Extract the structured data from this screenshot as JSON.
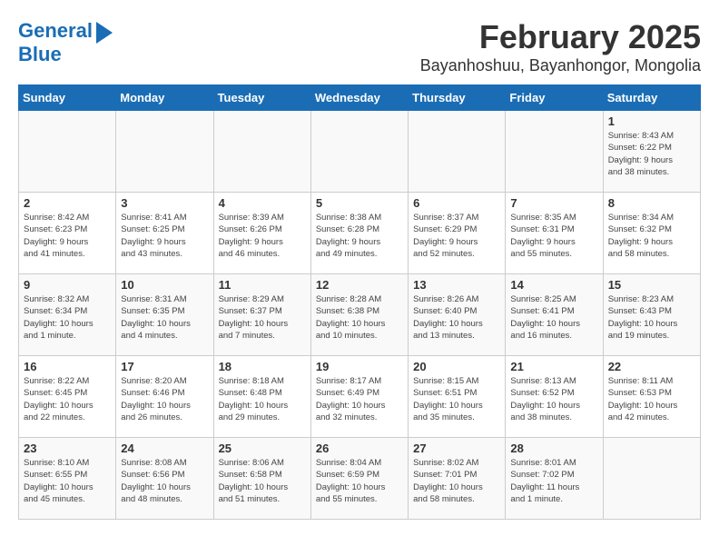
{
  "header": {
    "logo_line1": "General",
    "logo_line2": "Blue",
    "month": "February 2025",
    "location": "Bayanhoshuu, Bayanhongor, Mongolia"
  },
  "weekdays": [
    "Sunday",
    "Monday",
    "Tuesday",
    "Wednesday",
    "Thursday",
    "Friday",
    "Saturday"
  ],
  "weeks": [
    [
      {
        "day": "",
        "info": ""
      },
      {
        "day": "",
        "info": ""
      },
      {
        "day": "",
        "info": ""
      },
      {
        "day": "",
        "info": ""
      },
      {
        "day": "",
        "info": ""
      },
      {
        "day": "",
        "info": ""
      },
      {
        "day": "1",
        "info": "Sunrise: 8:43 AM\nSunset: 6:22 PM\nDaylight: 9 hours\nand 38 minutes."
      }
    ],
    [
      {
        "day": "2",
        "info": "Sunrise: 8:42 AM\nSunset: 6:23 PM\nDaylight: 9 hours\nand 41 minutes."
      },
      {
        "day": "3",
        "info": "Sunrise: 8:41 AM\nSunset: 6:25 PM\nDaylight: 9 hours\nand 43 minutes."
      },
      {
        "day": "4",
        "info": "Sunrise: 8:39 AM\nSunset: 6:26 PM\nDaylight: 9 hours\nand 46 minutes."
      },
      {
        "day": "5",
        "info": "Sunrise: 8:38 AM\nSunset: 6:28 PM\nDaylight: 9 hours\nand 49 minutes."
      },
      {
        "day": "6",
        "info": "Sunrise: 8:37 AM\nSunset: 6:29 PM\nDaylight: 9 hours\nand 52 minutes."
      },
      {
        "day": "7",
        "info": "Sunrise: 8:35 AM\nSunset: 6:31 PM\nDaylight: 9 hours\nand 55 minutes."
      },
      {
        "day": "8",
        "info": "Sunrise: 8:34 AM\nSunset: 6:32 PM\nDaylight: 9 hours\nand 58 minutes."
      }
    ],
    [
      {
        "day": "9",
        "info": "Sunrise: 8:32 AM\nSunset: 6:34 PM\nDaylight: 10 hours\nand 1 minute."
      },
      {
        "day": "10",
        "info": "Sunrise: 8:31 AM\nSunset: 6:35 PM\nDaylight: 10 hours\nand 4 minutes."
      },
      {
        "day": "11",
        "info": "Sunrise: 8:29 AM\nSunset: 6:37 PM\nDaylight: 10 hours\nand 7 minutes."
      },
      {
        "day": "12",
        "info": "Sunrise: 8:28 AM\nSunset: 6:38 PM\nDaylight: 10 hours\nand 10 minutes."
      },
      {
        "day": "13",
        "info": "Sunrise: 8:26 AM\nSunset: 6:40 PM\nDaylight: 10 hours\nand 13 minutes."
      },
      {
        "day": "14",
        "info": "Sunrise: 8:25 AM\nSunset: 6:41 PM\nDaylight: 10 hours\nand 16 minutes."
      },
      {
        "day": "15",
        "info": "Sunrise: 8:23 AM\nSunset: 6:43 PM\nDaylight: 10 hours\nand 19 minutes."
      }
    ],
    [
      {
        "day": "16",
        "info": "Sunrise: 8:22 AM\nSunset: 6:45 PM\nDaylight: 10 hours\nand 22 minutes."
      },
      {
        "day": "17",
        "info": "Sunrise: 8:20 AM\nSunset: 6:46 PM\nDaylight: 10 hours\nand 26 minutes."
      },
      {
        "day": "18",
        "info": "Sunrise: 8:18 AM\nSunset: 6:48 PM\nDaylight: 10 hours\nand 29 minutes."
      },
      {
        "day": "19",
        "info": "Sunrise: 8:17 AM\nSunset: 6:49 PM\nDaylight: 10 hours\nand 32 minutes."
      },
      {
        "day": "20",
        "info": "Sunrise: 8:15 AM\nSunset: 6:51 PM\nDaylight: 10 hours\nand 35 minutes."
      },
      {
        "day": "21",
        "info": "Sunrise: 8:13 AM\nSunset: 6:52 PM\nDaylight: 10 hours\nand 38 minutes."
      },
      {
        "day": "22",
        "info": "Sunrise: 8:11 AM\nSunset: 6:53 PM\nDaylight: 10 hours\nand 42 minutes."
      }
    ],
    [
      {
        "day": "23",
        "info": "Sunrise: 8:10 AM\nSunset: 6:55 PM\nDaylight: 10 hours\nand 45 minutes."
      },
      {
        "day": "24",
        "info": "Sunrise: 8:08 AM\nSunset: 6:56 PM\nDaylight: 10 hours\nand 48 minutes."
      },
      {
        "day": "25",
        "info": "Sunrise: 8:06 AM\nSunset: 6:58 PM\nDaylight: 10 hours\nand 51 minutes."
      },
      {
        "day": "26",
        "info": "Sunrise: 8:04 AM\nSunset: 6:59 PM\nDaylight: 10 hours\nand 55 minutes."
      },
      {
        "day": "27",
        "info": "Sunrise: 8:02 AM\nSunset: 7:01 PM\nDaylight: 10 hours\nand 58 minutes."
      },
      {
        "day": "28",
        "info": "Sunrise: 8:01 AM\nSunset: 7:02 PM\nDaylight: 11 hours\nand 1 minute."
      },
      {
        "day": "",
        "info": ""
      }
    ]
  ]
}
